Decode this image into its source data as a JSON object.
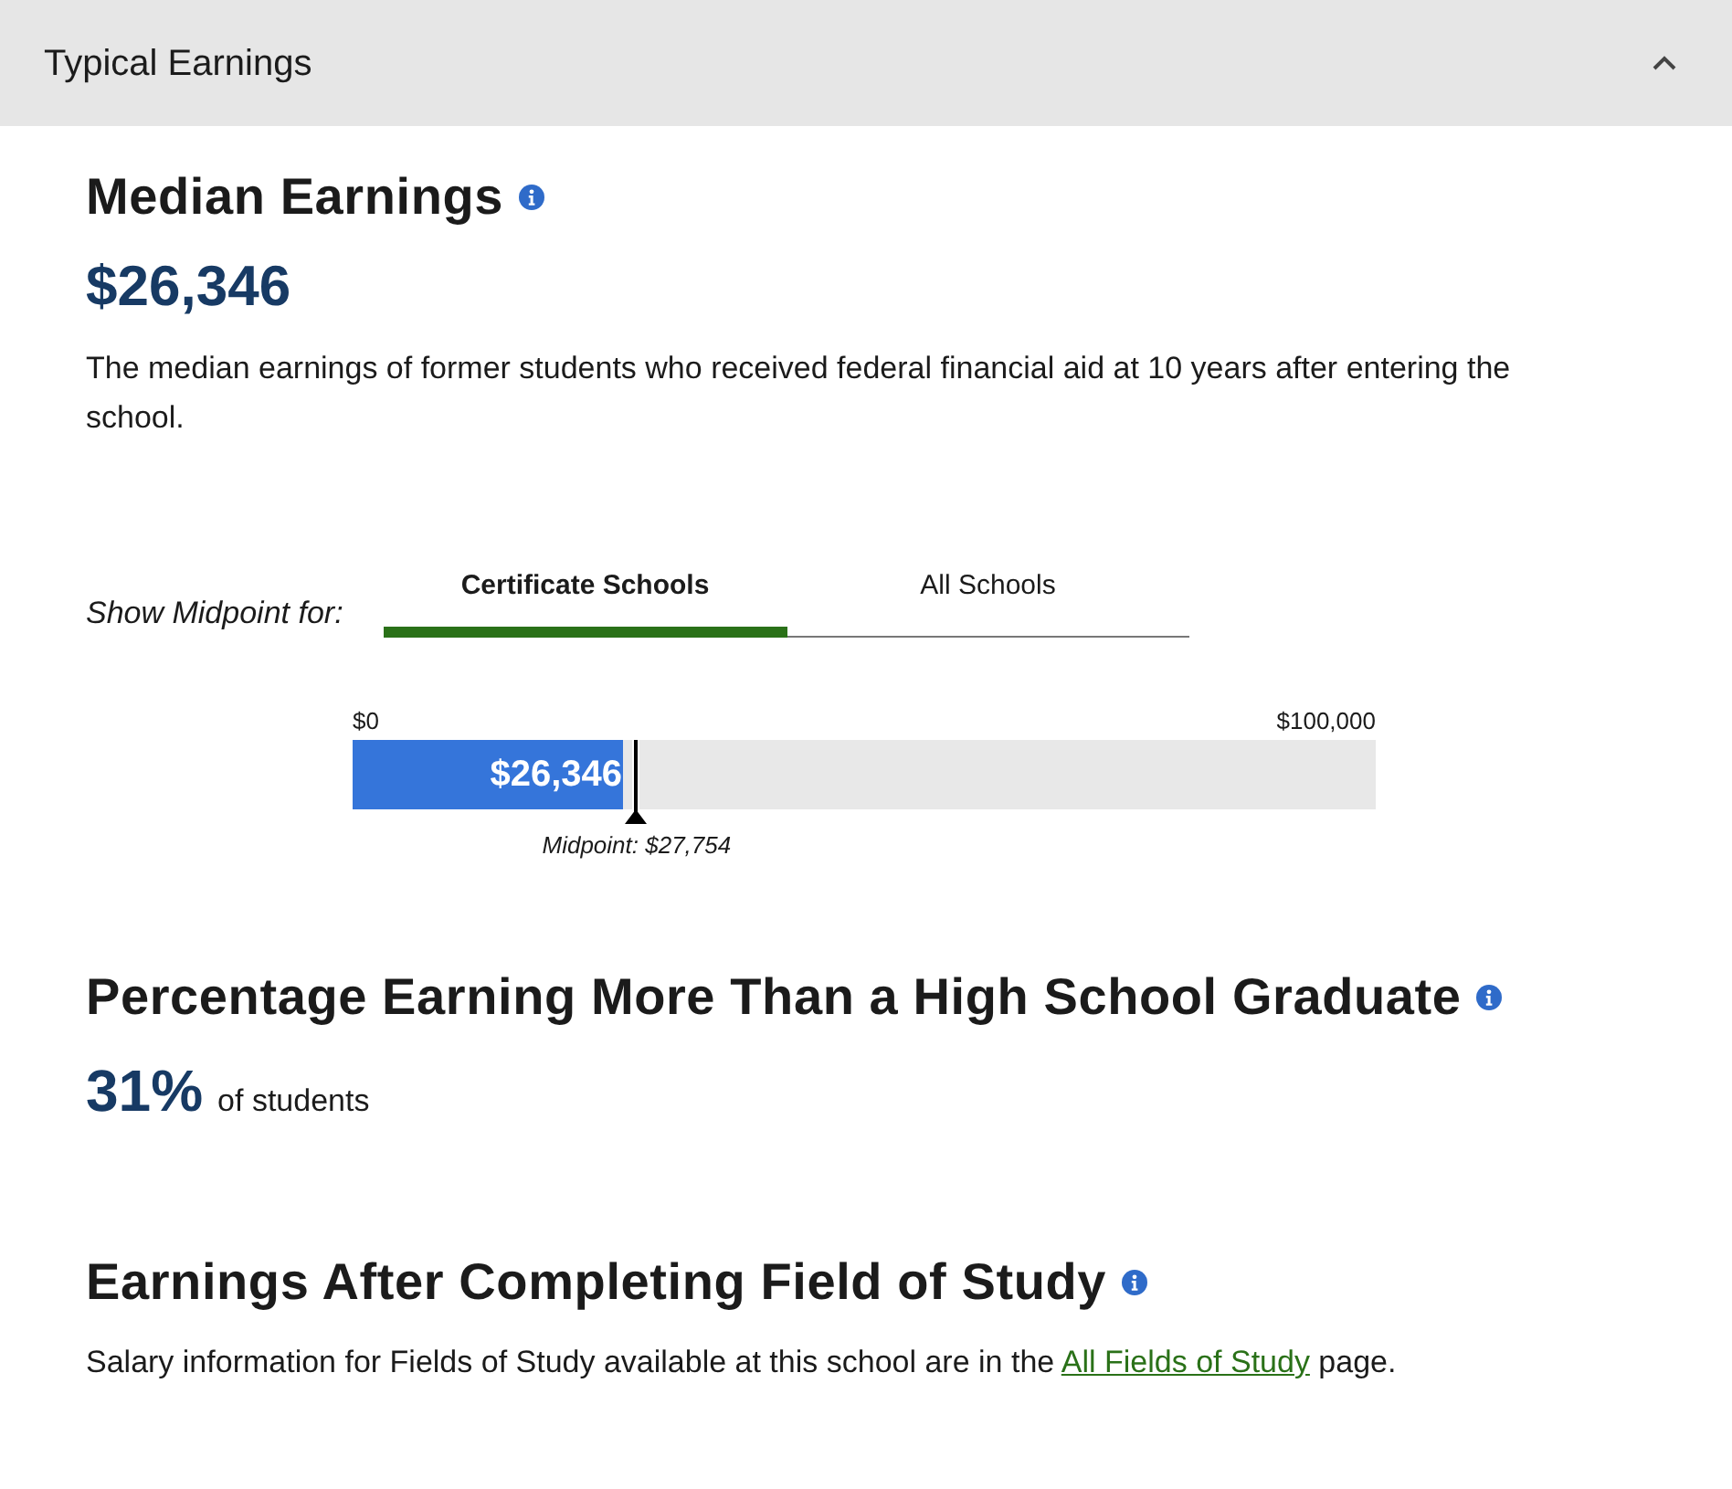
{
  "accordion": {
    "title": "Typical Earnings",
    "expanded": true
  },
  "median_earnings": {
    "heading": "Median Earnings",
    "value": "$26,346",
    "description": "The median earnings of former students who received federal financial aid at 10 years after entering the school."
  },
  "midpoint_selector": {
    "label": "Show Midpoint for:",
    "tabs": [
      {
        "label": "Certificate Schools",
        "selected": true
      },
      {
        "label": "All Schools",
        "selected": false
      }
    ]
  },
  "earnings_bar": {
    "min_label": "$0",
    "max_label": "$100,000",
    "value_label": "$26,346",
    "level": 0.26346,
    "midpoint": {
      "label": "Midpoint: $27,754",
      "level": 0.27754
    }
  },
  "percentage_section": {
    "heading": "Percentage Earning More Than a High School Graduate",
    "value": "31%",
    "suffix": "of students"
  },
  "field_of_study": {
    "heading": "Earnings After Completing Field of Study",
    "text_before": "Salary information for Fields of Study available at this school are in the",
    "link": "All Fields of Study",
    "text_after": "page."
  }
}
